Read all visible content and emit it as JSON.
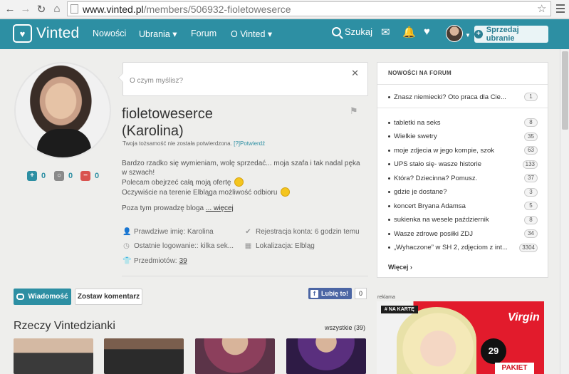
{
  "browser": {
    "url_host": "www.vinted.pl",
    "url_path": "/members/506932-fioletoweserce"
  },
  "header": {
    "brand": "Vinted",
    "nav": [
      {
        "label": "Nowości"
      },
      {
        "label": "Ubrania ▾"
      },
      {
        "label": "Forum"
      },
      {
        "label": "O Vinted ▾"
      }
    ],
    "search_label": "Szukaj",
    "sell_label": "Sprzedaj ubranie"
  },
  "status": {
    "placeholder": "O czym myślisz?"
  },
  "profile": {
    "username": "fioletoweserce",
    "real_name": "(Karolina)",
    "verify_text": "Twoja tożsamość nie została potwierdzona.",
    "verify_help": "[?]",
    "verify_link": "Potwierdź",
    "stats": {
      "positive": "0",
      "neutral": "0",
      "negative": "0"
    },
    "bio": {
      "line1": "Bardzo rzadko się wymieniam, wolę sprzedać... moja szafa i tak nadal pęka w szwach!",
      "line2": "Polecam obejrzeć całą moją ofertę",
      "line3": "Oczywiście na terenie Elbląga możliwość odbioru",
      "line4": "Poza tym prowadzę bloga",
      "more": "... więcej"
    },
    "info": {
      "name": "Prawdziwe imię: Karolina",
      "registered": "Rejestracja konta: 6 godzin temu",
      "last_login": "Ostatnie logowanie:: kilka sek...",
      "location": "Lokalizacja: Elbląg",
      "items_label": "Przedmiotów:",
      "items_count": "39"
    },
    "actions": {
      "message": "Wiadomość",
      "comment": "Zostaw komentarz",
      "fb_like": "Lubię to!",
      "fb_count": "0"
    }
  },
  "items": {
    "title": "Rzeczy Vintedzianki",
    "all_link": "wszystkie (39)"
  },
  "forum": {
    "title": "NOWOŚCI NA FORUM",
    "pinned": [
      {
        "title": "Znasz niemiecki? Oto praca dla Cie...",
        "count": "1"
      }
    ],
    "topics": [
      {
        "title": "tabletki na seks",
        "count": "8"
      },
      {
        "title": "Wielkie swetry",
        "count": "35"
      },
      {
        "title": "moje zdjecia w jego kompie, szok",
        "count": "63"
      },
      {
        "title": "UPS stało się- wasze historie",
        "count": "133"
      },
      {
        "title": "Która? Dziecinna? Pomusz.",
        "count": "37"
      },
      {
        "title": "gdzie je dostane?",
        "count": "3"
      },
      {
        "title": "koncert Bryana Adamsa",
        "count": "5"
      },
      {
        "title": "sukienka na wesele październik",
        "count": "8"
      },
      {
        "title": "Wasze zdrowe posiłki ZDJ",
        "count": "34"
      },
      {
        "title": "„Wyhaczone” w SH 2, zdjęciom z int...",
        "count": "3304"
      }
    ],
    "more": "Więcej ›"
  },
  "ad": {
    "label": "reklama",
    "tag": "# NA KARTĘ",
    "brand": "Virgin",
    "price": "29",
    "pakiet": "PAKIET"
  },
  "colors": {
    "brand_teal": "#2d8fa3",
    "negative_red": "#d9534f",
    "ad_red": "#e21b2c"
  }
}
